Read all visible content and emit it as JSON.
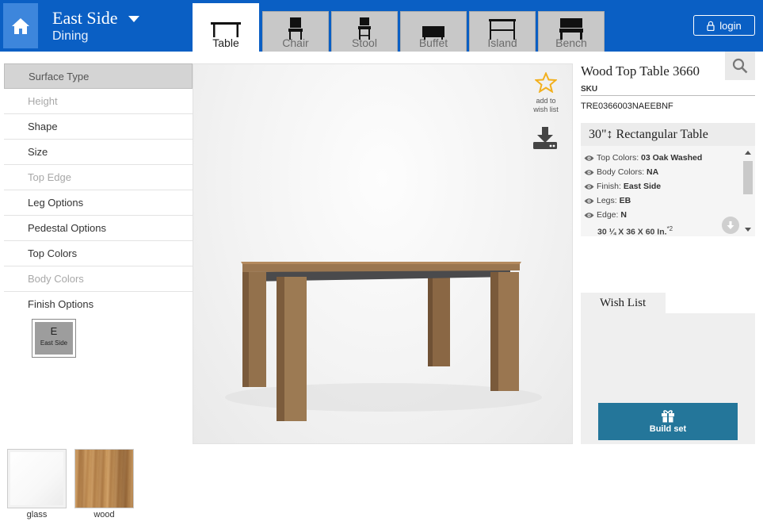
{
  "header": {
    "collection_name": "East Side",
    "collection_sub": "Dining",
    "login_label": "login",
    "tabs": [
      {
        "label": "Table",
        "icon": "table-icon",
        "active": true
      },
      {
        "label": "Chair",
        "icon": "chair-icon",
        "active": false
      },
      {
        "label": "Stool",
        "icon": "stool-icon",
        "active": false
      },
      {
        "label": "Buffet",
        "icon": "buffet-icon",
        "active": false
      },
      {
        "label": "Island",
        "icon": "island-icon",
        "active": false
      },
      {
        "label": "Bench",
        "icon": "bench-icon",
        "active": false
      }
    ]
  },
  "sidebar": {
    "items": [
      {
        "label": "Surface Type",
        "state": "active"
      },
      {
        "label": "Height",
        "state": "disabled"
      },
      {
        "label": "Shape",
        "state": "normal"
      },
      {
        "label": "Size",
        "state": "normal"
      },
      {
        "label": "Top Edge",
        "state": "disabled"
      },
      {
        "label": "Leg Options",
        "state": "normal"
      },
      {
        "label": "Pedestal Options",
        "state": "normal"
      },
      {
        "label": "Top Colors",
        "state": "normal"
      },
      {
        "label": "Body Colors",
        "state": "disabled"
      },
      {
        "label": "Finish Options",
        "state": "normal"
      }
    ],
    "finish_swatch": {
      "code": "E",
      "label": "East Side"
    }
  },
  "viewer": {
    "wish_add_label_1": "add to",
    "wish_add_label_2": "wish list"
  },
  "product": {
    "name": "Wood Top Table 3660",
    "sku_label": "SKU",
    "sku_value": "TRE0366003NAEEBNF",
    "spec_title": "30\"↕ Rectangular Table",
    "specs": [
      {
        "label": "Top Colors: ",
        "value": "03 Oak Washed"
      },
      {
        "label": "Body Colors: ",
        "value": "NA"
      },
      {
        "label": "Finish: ",
        "value": "East Side"
      },
      {
        "label": "Legs: ",
        "value": "EB"
      },
      {
        "label": "Edge: ",
        "value": "N"
      }
    ],
    "dimensions": "30 ¼ X 36 X 60 In.",
    "dimensions_sup": "*2"
  },
  "wishlist": {
    "tab_label": "Wish List",
    "build_label": "Build set"
  },
  "materials": [
    {
      "label": "glass"
    },
    {
      "label": "wood"
    }
  ],
  "colors": {
    "header_blue": "#0a5fc4",
    "build_button": "#24769a",
    "star": "#f2b01e"
  }
}
